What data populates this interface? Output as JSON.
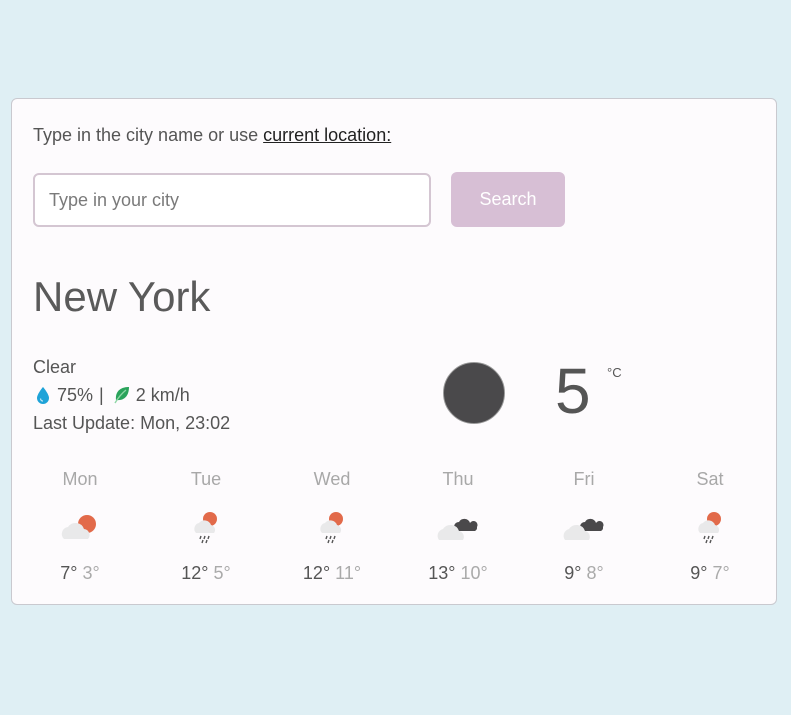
{
  "search": {
    "prompt_text": "Type in the city name or use",
    "location_link": "current location:",
    "placeholder": "Type in your city",
    "button_label": "Search"
  },
  "current": {
    "city": "New York",
    "description": "Clear",
    "humidity": "75%",
    "separator": "|",
    "wind": "2 km/h",
    "last_update": "Last Update: Mon, 23:02",
    "temperature": "5",
    "unit": "°C",
    "icon": "clear-night-moon-icon"
  },
  "forecast": [
    {
      "day": "Mon",
      "high": "7°",
      "low": "3°",
      "icon": "partly-cloudy-icon"
    },
    {
      "day": "Tue",
      "high": "12°",
      "low": "5°",
      "icon": "rain-sun-icon"
    },
    {
      "day": "Wed",
      "high": "12°",
      "low": "11°",
      "icon": "rain-sun-icon"
    },
    {
      "day": "Thu",
      "high": "13°",
      "low": "10°",
      "icon": "cloudy-icon"
    },
    {
      "day": "Fri",
      "high": "9°",
      "low": "8°",
      "icon": "cloudy-icon"
    },
    {
      "day": "Sat",
      "high": "9°",
      "low": "7°",
      "icon": "rain-sun-icon"
    }
  ],
  "colors": {
    "page_bg": "#dfeff4",
    "card_bg": "#fdfbfd",
    "button_bg": "#d7bfd5",
    "sun": "#e26a4a",
    "cloud_dark": "#4a494b",
    "cloud_light": "#e9e9ea",
    "drop": "#1fa3d8",
    "leaf": "#2aa35b"
  }
}
